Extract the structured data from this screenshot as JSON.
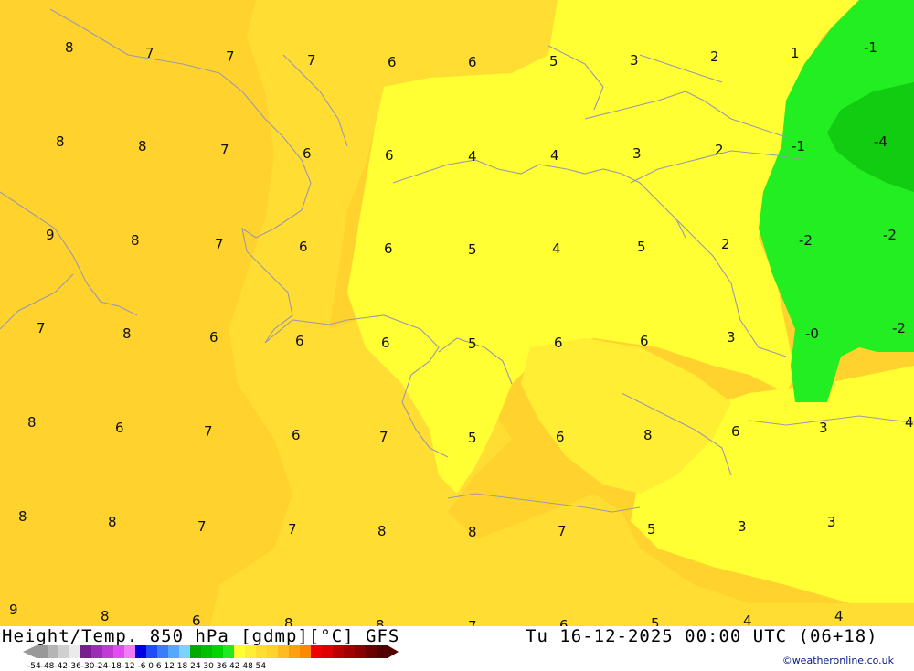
{
  "map": {
    "temperature_labels": [
      "8",
      "7",
      "7",
      "7",
      "6",
      "6",
      "5",
      "3",
      "2",
      "1",
      "-1",
      "8",
      "8",
      "7",
      "6",
      "6",
      "4",
      "4",
      "3",
      "2",
      "-1",
      "-4",
      "9",
      "8",
      "7",
      "6",
      "6",
      "5",
      "4",
      "5",
      "2",
      "-2",
      "-2",
      "7",
      "8",
      "6",
      "6",
      "6",
      "5",
      "6",
      "6",
      "3",
      "-0",
      "-2",
      "8",
      "6",
      "7",
      "6",
      "7",
      "5",
      "6",
      "8",
      "6",
      "3",
      "4",
      "8",
      "8",
      "7",
      "7",
      "8",
      "8",
      "7",
      "5",
      "3",
      "3",
      "9",
      "8",
      "6",
      "8",
      "8",
      "7",
      "6",
      "5",
      "4",
      "4"
    ],
    "colors": {
      "band_0_to_6": "#ffff33",
      "band_6_to_9": "#ffdd33",
      "band_9_to_12": "#ffd22e",
      "band_neg3_to_0": "#22ee22",
      "band_neg6_to_neg3": "#11cc11",
      "coastline": "#9a9aaa"
    }
  },
  "footer": {
    "title": "Height/Temp. 850 hPa [gdmp][°C] GFS",
    "datetime": "Tu 16-12-2025 00:00 UTC (06+18)",
    "credit": "©weatheronline.co.uk",
    "scale_ticks": "-54-48-42-36-30-24-18-12 -6  0  6  12  18  24  30  36  42  48  54",
    "legend_colors": [
      "#999999",
      "#b5b5b5",
      "#d0d0d0",
      "#ebebeb",
      "#7a1f8f",
      "#9d2cb6",
      "#c13ad5",
      "#e04cf0",
      "#f07cf7",
      "#0000e0",
      "#1e4cf5",
      "#3a7cfa",
      "#56a8fc",
      "#7ad2fe",
      "#00aa00",
      "#00c000",
      "#00d500",
      "#22ea22",
      "#ffff33",
      "#ffee33",
      "#ffdd33",
      "#ffd22e",
      "#ffbb22",
      "#ffa011",
      "#ff8800",
      "#ee0000",
      "#dd0000",
      "#bb0000",
      "#a00000",
      "#880000",
      "#6a0000",
      "#500000"
    ]
  }
}
